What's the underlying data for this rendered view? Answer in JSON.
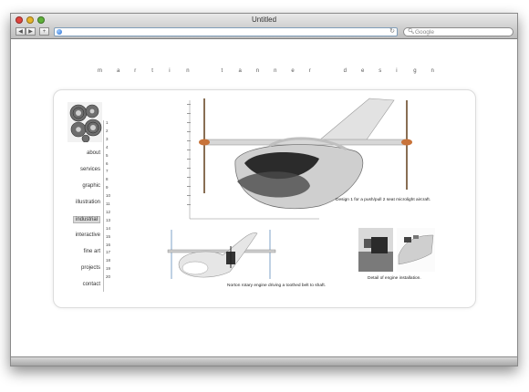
{
  "window": {
    "title": "Untitled"
  },
  "search": {
    "placeholder": "Google"
  },
  "brand_letters": [
    "m",
    "a",
    "r",
    "t",
    "i",
    "n",
    "",
    "t",
    "a",
    "n",
    "n",
    "e",
    "r",
    "",
    "d",
    "e",
    "s",
    "i",
    "g",
    "n"
  ],
  "nav": [
    {
      "label": "about",
      "active": false
    },
    {
      "label": "services",
      "active": false
    },
    {
      "label": "graphic",
      "active": false
    },
    {
      "label": "illustration",
      "active": false
    },
    {
      "label": "industrial",
      "active": true
    },
    {
      "label": "interactive",
      "active": false
    },
    {
      "label": "fine art",
      "active": false
    },
    {
      "label": "projects",
      "active": false
    },
    {
      "label": "contact",
      "active": false
    }
  ],
  "page_numbers": [
    "1",
    "2",
    "3",
    "4",
    "5",
    "6",
    "7",
    "8",
    "9",
    "10",
    "11",
    "12",
    "13",
    "14",
    "15",
    "16",
    "17",
    "18",
    "19",
    "20"
  ],
  "captions": {
    "main": "Design 1 for a push/pull 2 seat microlight aircraft.",
    "belt": "Norton rotary engine driving a toothed belt to shaft.",
    "engine": "Detail of engine installation."
  }
}
